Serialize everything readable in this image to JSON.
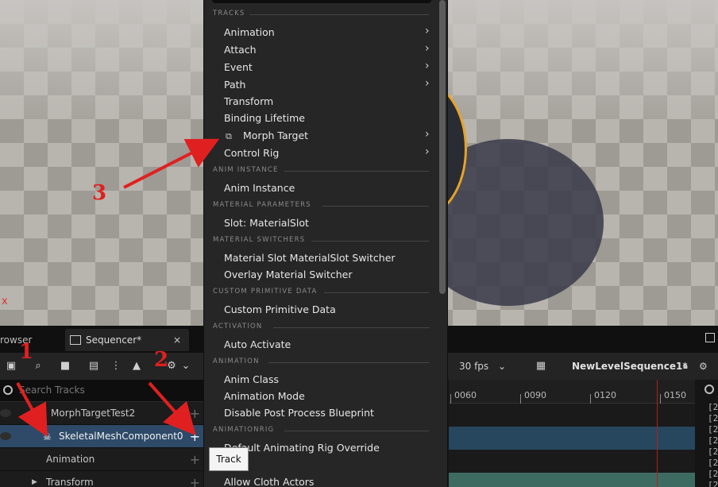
{
  "viewport": {
    "axis_label": "x"
  },
  "tabs": {
    "content_browser": "rowser",
    "sequencer": "Sequencer*",
    "close": "×"
  },
  "toolbar": {
    "fps": "30 fps",
    "sequence_name": "NewLevelSequence1*"
  },
  "search": {
    "placeholder": "Search Tracks"
  },
  "tree": {
    "rows": [
      {
        "label": "MorphTargetTest2"
      },
      {
        "label": "SkeletalMeshComponent0"
      },
      {
        "label": "Animation"
      },
      {
        "label": "Transform"
      }
    ]
  },
  "timeline": {
    "ticks": [
      "0060",
      "0090",
      "0120",
      "0150"
    ]
  },
  "right_pane": {
    "lines": [
      "[2",
      "[2",
      "[2",
      "[2",
      "[2",
      "[2",
      "[2",
      "[2",
      "[2"
    ]
  },
  "menu": {
    "sections": {
      "tracks": "TRACKS",
      "anim_instance": "ANIM INSTANCE",
      "material_parameters": "MATERIAL PARAMETERS",
      "material_switchers": "MATERIAL SWITCHERS",
      "custom_primitive_data": "CUSTOM PRIMITIVE DATA",
      "activation": "ACTIVATION",
      "animation": "ANIMATION",
      "animationrig": "ANIMATIONRIG"
    },
    "items": {
      "animation": "Animation",
      "attach": "Attach",
      "event": "Event",
      "path": "Path",
      "transform": "Transform",
      "binding_lifetime": "Binding Lifetime",
      "morph_target": "Morph Target",
      "control_rig": "Control Rig",
      "anim_instance": "Anim Instance",
      "slot_material": "Slot: MaterialSlot",
      "material_slot_switcher": "Material Slot MaterialSlot Switcher",
      "overlay_material_switcher": "Overlay Material Switcher",
      "custom_primitive_data": "Custom Primitive Data",
      "auto_activate": "Auto Activate",
      "anim_class": "Anim Class",
      "animation_mode": "Animation Mode",
      "disable_post_process": "Disable Post Process Blueprint",
      "default_animating_rig": "Default Animating Rig Override",
      "allow_cloth_actors": "Allow Cloth Actors"
    }
  },
  "tooltip": {
    "text": "Track"
  },
  "annotations": {
    "one": "1",
    "two": "2",
    "three": "3"
  },
  "colors": {
    "accent_red": "#e02020",
    "selection_blue": "#2e4a68",
    "sphere_outline": "#e7a326"
  }
}
